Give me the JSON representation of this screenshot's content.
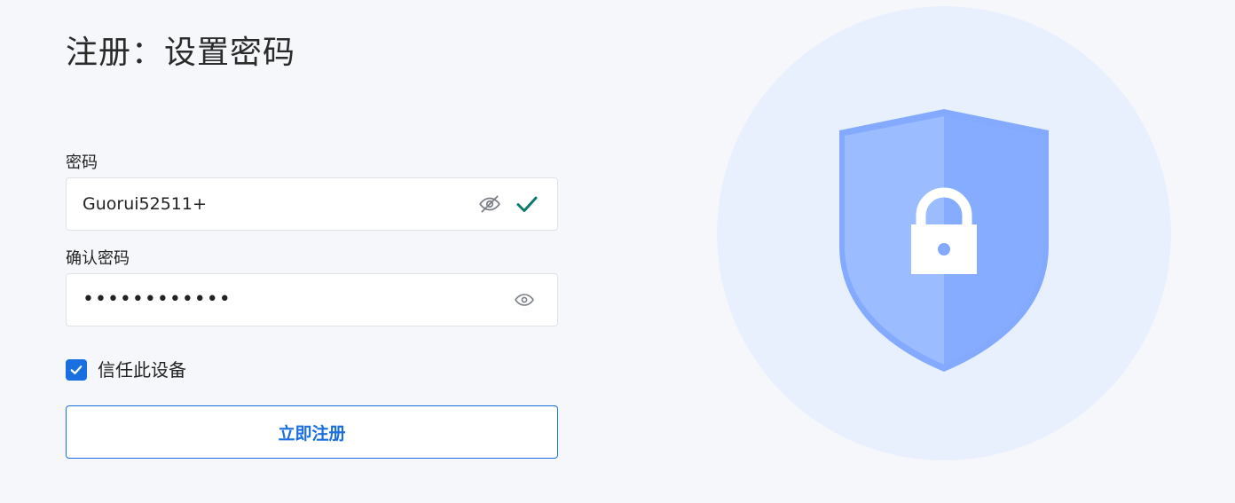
{
  "header": {
    "title": "注册：设置密码"
  },
  "form": {
    "password": {
      "label": "密码",
      "value": "Guorui52511+",
      "visibility_icon": "eye-slash-icon",
      "valid_icon": "check-icon"
    },
    "confirm_password": {
      "label": "确认密码",
      "value": "••••••••••••",
      "visibility_icon": "eye-icon"
    },
    "trust_device": {
      "label": "信任此设备",
      "checked": true
    },
    "submit": {
      "label": "立即注册"
    }
  },
  "illustration": {
    "icon": "shield-lock-icon"
  },
  "colors": {
    "accent": "#1a6fe0",
    "success": "#0f7a6a",
    "background": "#f5f7fa",
    "illustration_circle": "#e8f0fe",
    "shield_light": "#9bbcff",
    "shield_dark": "#84aaff"
  }
}
